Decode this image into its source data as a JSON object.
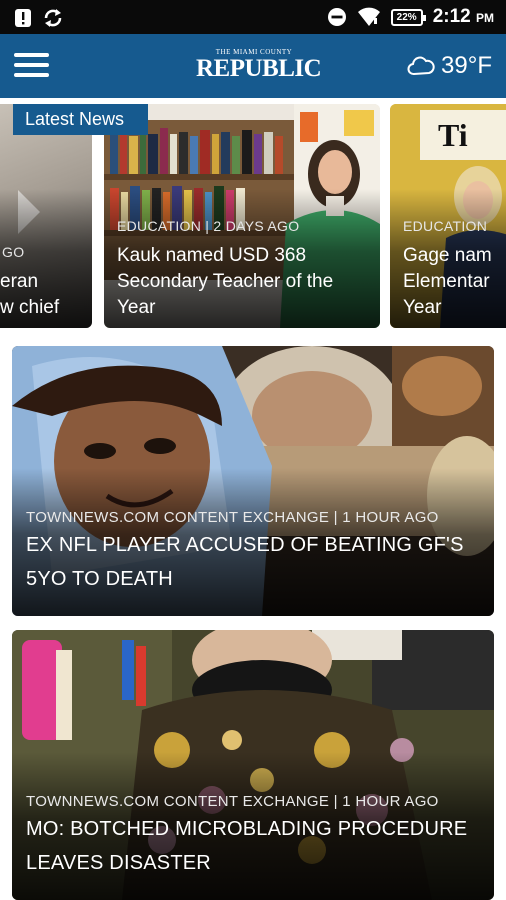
{
  "status_bar": {
    "time": "2:12",
    "ampm": "PM",
    "battery": "22%"
  },
  "header": {
    "logo_top": "THE MIAMI COUNTY",
    "logo_main": "REPUBLIC",
    "temperature": "39°F",
    "weather_icon": "cloud-icon",
    "menu_icon": "hamburger-menu-icon"
  },
  "latest_news": {
    "badge": "Latest News",
    "cards": [
      {
        "meta": "GO",
        "headline_lines": [
          "eran",
          "w chief"
        ]
      },
      {
        "meta": "EDUCATION | 2 DAYS AGO",
        "headline_lines": [
          "Kauk named USD 368",
          "Secondary Teacher of the",
          "Year"
        ]
      },
      {
        "meta": "EDUCATION",
        "headline_lines": [
          "Gage nam",
          "Elementar",
          "Year"
        ]
      }
    ]
  },
  "articles": [
    {
      "meta": "TOWNNEWS.COM CONTENT EXCHANGE | 1 HOUR AGO",
      "headline_lines": [
        "EX NFL PLAYER ACCUSED OF BEATING GF'S",
        "5YO TO DEATH"
      ]
    },
    {
      "meta": "TOWNNEWS.COM CONTENT EXCHANGE | 1 HOUR AGO",
      "headline_lines": [
        "MO: BOTCHED MICROBLADING PROCEDURE",
        "LEAVES DISASTER"
      ]
    }
  ]
}
